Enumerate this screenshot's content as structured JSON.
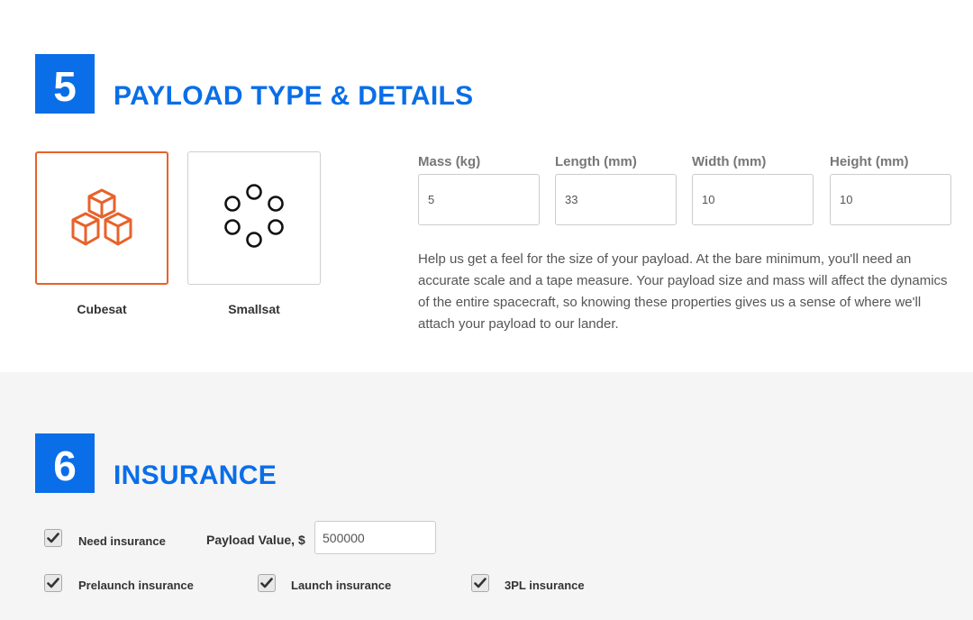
{
  "section5": {
    "number": "5",
    "title": "PAYLOAD TYPE & DETAILS",
    "types": [
      {
        "label": "Cubesat",
        "icon": "cubes-icon",
        "selected": true
      },
      {
        "label": "Smallsat",
        "icon": "circles-icon",
        "selected": false
      }
    ],
    "fields": [
      {
        "label": "Mass (kg)",
        "value": "5"
      },
      {
        "label": "Length (mm)",
        "value": "33"
      },
      {
        "label": "Width (mm)",
        "value": "10"
      },
      {
        "label": "Height (mm)",
        "value": "10"
      }
    ],
    "help": "Help us get a feel for the size of your payload. At the bare minimum, you'll need an accurate scale and a tape measure. Your payload size and mass will affect the dynamics of the entire spacecraft, so knowing these properties gives us a sense of where we'll attach your payload to our lander."
  },
  "section6": {
    "number": "6",
    "title": "INSURANCE",
    "need_insurance": {
      "label": "Need insurance",
      "checked": true
    },
    "payload_value": {
      "label": "Payload Value, $",
      "value": "500000"
    },
    "options": [
      {
        "label": "Prelaunch insurance",
        "checked": true
      },
      {
        "label": "Launch insurance",
        "checked": true
      },
      {
        "label": "3PL insurance",
        "checked": true
      }
    ]
  },
  "colors": {
    "accent": "#0a6ee8",
    "selected_border": "#e8622a",
    "section_bg": "#f5f5f5"
  }
}
